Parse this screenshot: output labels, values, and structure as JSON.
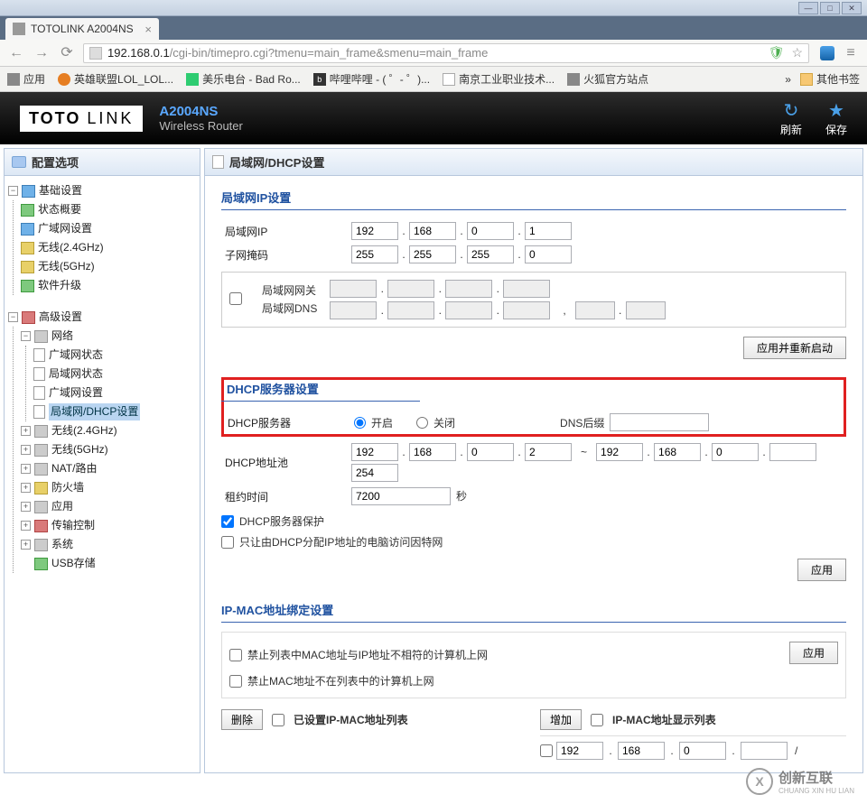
{
  "browser": {
    "tab_title": "TOTOLINK A2004NS",
    "url_host": "192.168.0.1",
    "url_path": "/cgi-bin/timepro.cgi?tmenu=main_frame&smenu=main_frame",
    "bookmarks": {
      "apps": "应用",
      "lol": "英雄联盟LOL_LOL...",
      "music": "美乐电台 - Bad Ro...",
      "bili": "哔哩哔哩 - ( ゜- ゜)...",
      "njpi": "南京工业职业技术...",
      "firefox": "火狐官方站点",
      "other": "其他书签",
      "more": "»"
    }
  },
  "header": {
    "logo": "TOTO",
    "logo2": "LINK",
    "model": "A2004NS",
    "subtitle": "Wireless Router",
    "refresh": "刷新",
    "save": "保存"
  },
  "sidebar": {
    "title": "配置选项",
    "basic": {
      "label": "基础设置",
      "items": [
        "状态概要",
        "广域网设置",
        "无线(2.4GHz)",
        "无线(5GHz)",
        "软件升级"
      ]
    },
    "advanced": {
      "label": "高级设置",
      "network": {
        "label": "网络",
        "items": [
          "广域网状态",
          "局域网状态",
          "广域网设置",
          "局域网/DHCP设置"
        ]
      },
      "others": [
        "无线(2.4GHz)",
        "无线(5GHz)",
        "NAT/路由",
        "防火墙",
        "应用",
        "传输控制",
        "系统",
        "USB存储"
      ]
    }
  },
  "main": {
    "title": "局域网/DHCP设置",
    "lan_ip": {
      "section": "局域网IP设置",
      "ip_label": "局域网IP",
      "ip": [
        "192",
        "168",
        "0",
        "1"
      ],
      "mask_label": "子网掩码",
      "mask": [
        "255",
        "255",
        "255",
        "0"
      ],
      "gateway_label": "局域网网关",
      "dns_label": "局域网DNS",
      "apply_restart": "应用并重新启动"
    },
    "dhcp": {
      "section": "DHCP服务器设置",
      "server_label": "DHCP服务器",
      "on": "开启",
      "off": "关闭",
      "dns_suffix": "DNS后缀",
      "pool_label": "DHCP地址池",
      "pool_start": [
        "192",
        "168",
        "0",
        "2"
      ],
      "pool_end": [
        "192",
        "168",
        "0",
        ""
      ],
      "pool_extra": "254",
      "lease_label": "租约时间",
      "lease_value": "7200",
      "lease_unit": "秒",
      "protect": "DHCP服务器保护",
      "only_dhcp": "只让由DHCP分配IP地址的电脑访问因特网",
      "apply": "应用"
    },
    "ipmac": {
      "section": "IP-MAC地址绑定设置",
      "deny_unmatched": "禁止列表中MAC地址与IP地址不相符的计算机上网",
      "deny_notinlist": "禁止MAC地址不在列表中的计算机上网",
      "apply": "应用",
      "delete": "删除",
      "add": "增加",
      "set_list_title": "已设置IP-MAC地址列表",
      "display_list_title": "IP-MAC地址显示列表",
      "row_ip": [
        "192",
        "168",
        "0",
        ""
      ],
      "slash": "/"
    }
  },
  "watermark": {
    "brand": "创新互联",
    "sub": "CHUANG XIN HU LIAN"
  }
}
